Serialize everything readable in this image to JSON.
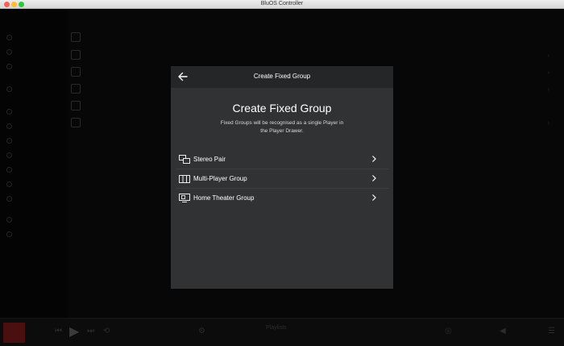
{
  "window": {
    "title": "BluOS Controller"
  },
  "modal": {
    "header_title": "Create Fixed Group",
    "heading": "Create Fixed Group",
    "description_line1": "Fixed Groups will be recognised as a single Player in",
    "description_line2": "the Player Drawer.",
    "options": [
      {
        "label": "Stereo Pair",
        "icon": "stereo-pair-icon"
      },
      {
        "label": "Multi-Player Group",
        "icon": "multi-player-group-icon"
      },
      {
        "label": "Home Theater Group",
        "icon": "home-theater-icon"
      }
    ]
  },
  "player": {
    "status": "Playlists"
  },
  "colors": {
    "modal_bg": "#303234",
    "modal_header_bg": "#252628",
    "app_bg": "#070707"
  }
}
